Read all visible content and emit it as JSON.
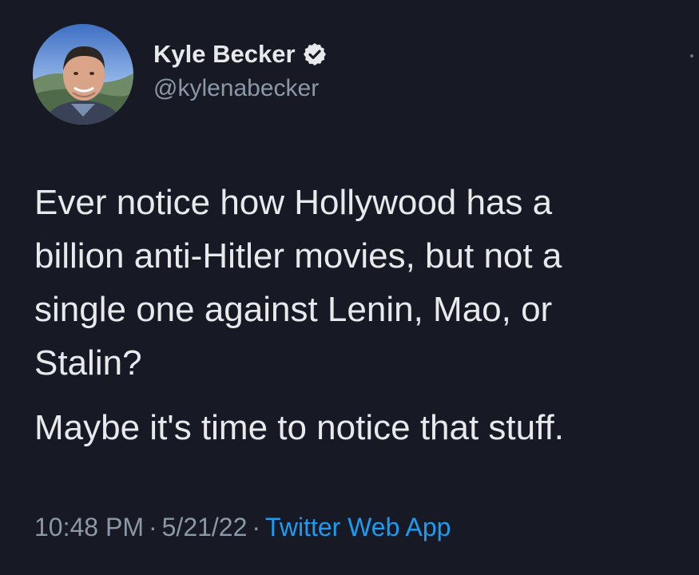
{
  "author": {
    "display_name": "Kyle Becker",
    "handle": "@kylenabecker",
    "verified_icon": "verified-badge-icon"
  },
  "tweet": {
    "paragraphs": [
      "Ever notice how Hollywood has a\nbillion anti-Hitler movies, but not a\nsingle one against Lenin, Mao, or\nStalin?",
      "Maybe it's time to notice that stuff."
    ]
  },
  "meta": {
    "time": "10:48 PM",
    "separator": "·",
    "date": "5/21/22",
    "source": "Twitter Web App"
  },
  "colors": {
    "background": "#171a24",
    "text": "#e7e9ea",
    "secondary_text": "#8b98a5",
    "link": "#1d9bf0"
  }
}
